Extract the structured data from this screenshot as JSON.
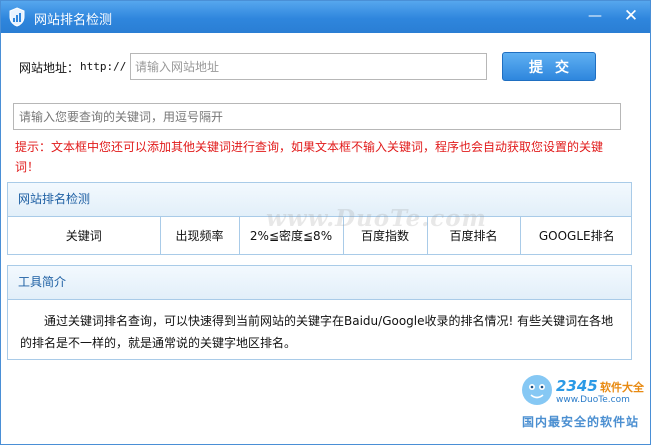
{
  "window": {
    "title": "网站排名检测",
    "minimize_symbol": "—",
    "close_symbol": "✕",
    "icon": "shield-chart-icon"
  },
  "url_row": {
    "label": "网站地址：",
    "prefix": "http://",
    "placeholder": "请输入网站地址",
    "value": "",
    "submit_label": "提交"
  },
  "keywords": {
    "placeholder": "请输入您要查询的关键词，用逗号隔开",
    "value": ""
  },
  "hint": "提示：文本框中您还可以添加其他关键词进行查询，如果文本框不输入关键词，程序也会自动获取您设置的关键词！",
  "rank_panel": {
    "title": "网站排名检测",
    "columns": [
      "关键词",
      "出现频率",
      "2%≦密度≦8%",
      "百度指数",
      "百度排名",
      "GOOGLE排名"
    ]
  },
  "tool_panel": {
    "title": "工具简介",
    "text": "通过关键词排名查询，可以快速得到当前网站的关键字在Baidu/Google收录的排名情况! 有些关键词在各地的排名是不一样的，就是通常说的关键字地区排名。"
  },
  "watermark": {
    "text": "www.DuoTe.com",
    "logo_number": "2345",
    "logo_brand": "软件大全",
    "logo_site": "www.DuoTe.com",
    "logo_slogan": "国内最安全的软件站"
  },
  "colors": {
    "titlebar": "#2f86dd",
    "hint_text": "#e11b1b",
    "panel_border": "#a9cbe8",
    "panel_title": "#1d5fa3"
  }
}
